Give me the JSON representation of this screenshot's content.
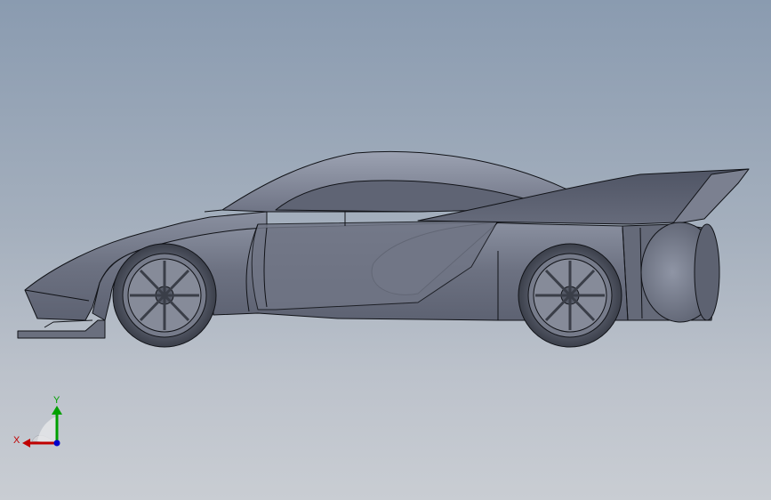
{
  "triad": {
    "x_label": "X",
    "y_label": "Y",
    "x_color": "#c00000",
    "y_color": "#00a000",
    "z_color": "#0000cc"
  },
  "colors": {
    "background_top": "#8a9bb0",
    "background_bottom": "#c9cdd3",
    "body_fill": "#6c7181",
    "body_light": "#8a90a0",
    "edge": "#111318"
  }
}
